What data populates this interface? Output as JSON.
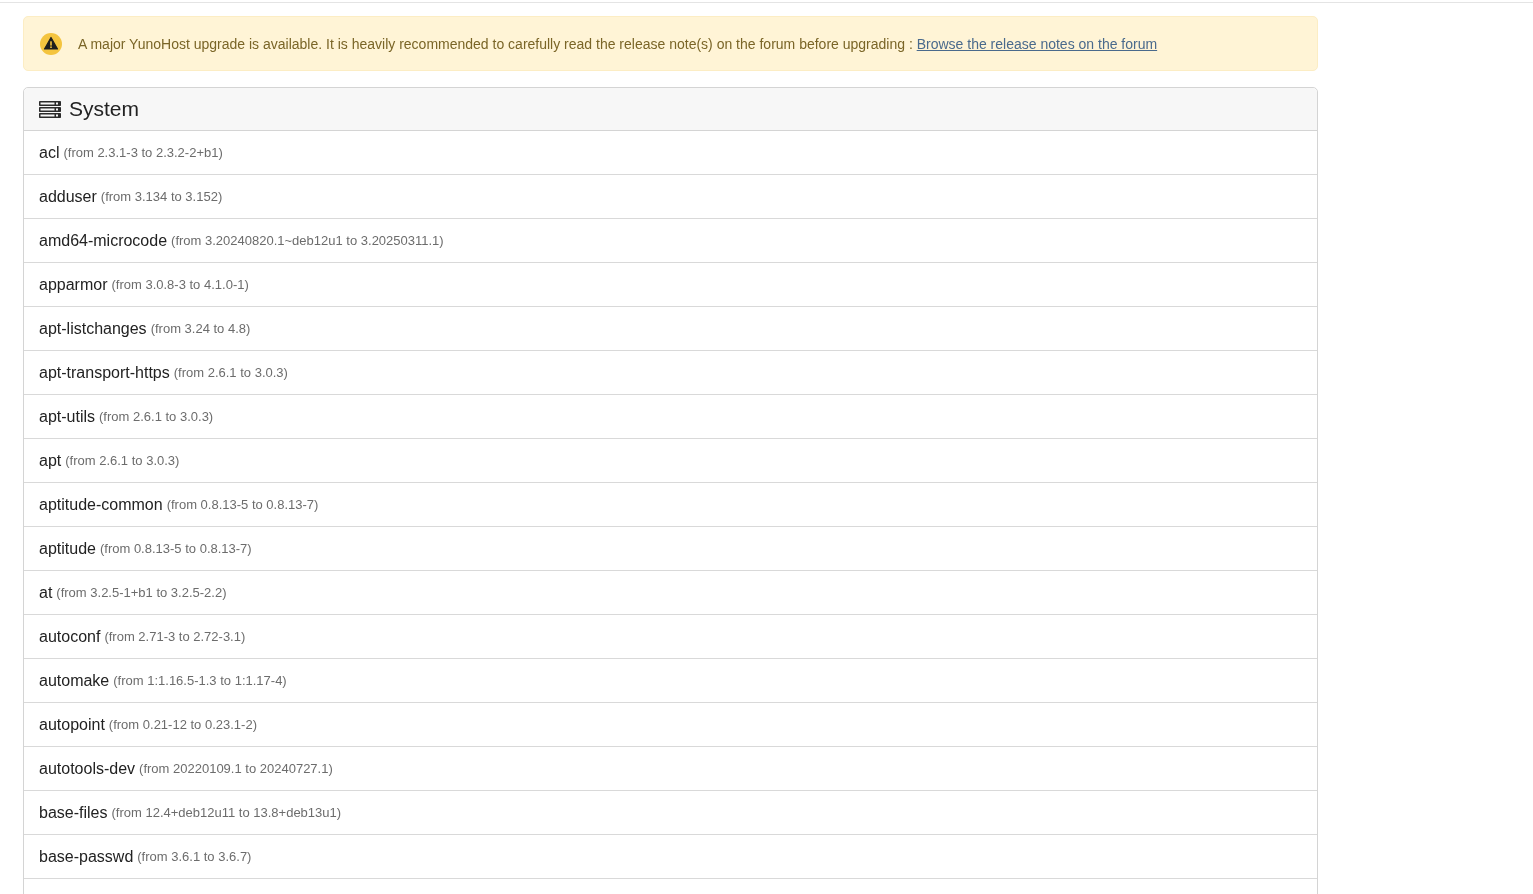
{
  "alert": {
    "message": "A major YunoHost upgrade is available. It is heavily recommended to carefully read the release note(s) on the forum before upgrading :",
    "link": "Browse the release notes on the forum"
  },
  "section": {
    "title": "System",
    "packages": [
      {
        "name": "acl",
        "change": "(from 2.3.1-3 to 2.3.2-2+b1)"
      },
      {
        "name": "adduser",
        "change": "(from 3.134 to 3.152)"
      },
      {
        "name": "amd64-microcode",
        "change": "(from 3.20240820.1~deb12u1 to 3.20250311.1)"
      },
      {
        "name": "apparmor",
        "change": "(from 3.0.8-3 to 4.1.0-1)"
      },
      {
        "name": "apt-listchanges",
        "change": "(from 3.24 to 4.8)"
      },
      {
        "name": "apt-transport-https",
        "change": "(from 2.6.1 to 3.0.3)"
      },
      {
        "name": "apt-utils",
        "change": "(from 2.6.1 to 3.0.3)"
      },
      {
        "name": "apt",
        "change": "(from 2.6.1 to 3.0.3)"
      },
      {
        "name": "aptitude-common",
        "change": "(from 0.8.13-5 to 0.8.13-7)"
      },
      {
        "name": "aptitude",
        "change": "(from 0.8.13-5 to 0.8.13-7)"
      },
      {
        "name": "at",
        "change": "(from 3.2.5-1+b1 to 3.2.5-2.2)"
      },
      {
        "name": "autoconf",
        "change": "(from 2.71-3 to 2.72-3.1)"
      },
      {
        "name": "automake",
        "change": "(from 1:1.16.5-1.3 to 1:1.17-4)"
      },
      {
        "name": "autopoint",
        "change": "(from 0.21-12 to 0.23.1-2)"
      },
      {
        "name": "autotools-dev",
        "change": "(from 20220109.1 to 20240727.1)"
      },
      {
        "name": "base-files",
        "change": "(from 12.4+deb12u11 to 13.8+deb13u1)"
      },
      {
        "name": "base-passwd",
        "change": "(from 3.6.1 to 3.6.7)"
      }
    ]
  }
}
